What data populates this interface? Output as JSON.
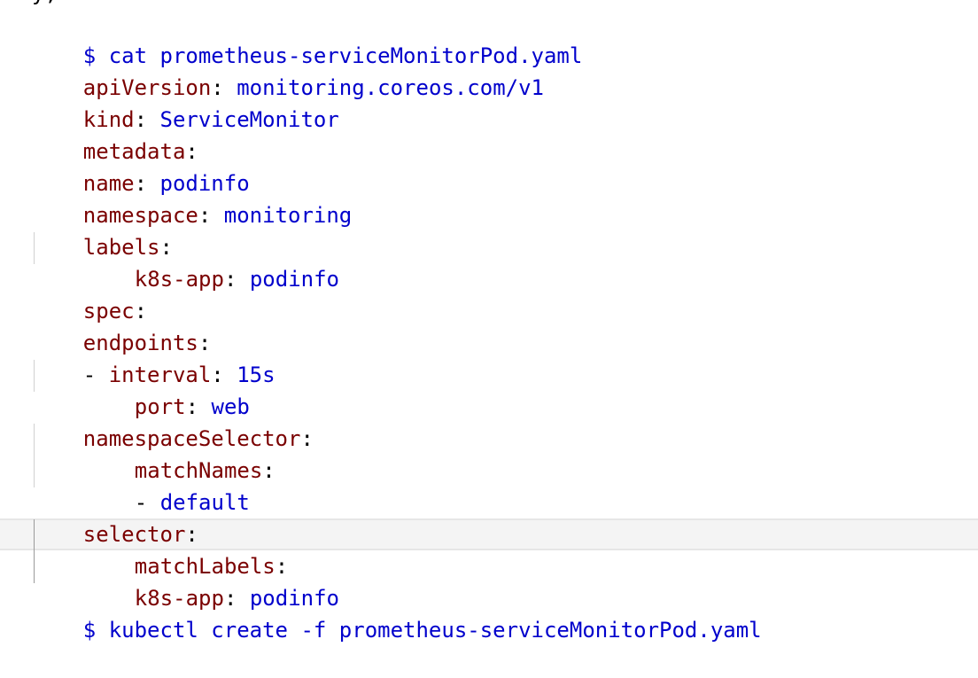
{
  "partial_top_text": "y;",
  "terminal": {
    "prompt": "$",
    "command1": "cat prometheus-serviceMonitorPod.yaml",
    "command2": "kubectl create -f prometheus-serviceMonitorPod.yaml"
  },
  "yaml": {
    "apiVersion": {
      "key": "apiVersion",
      "value": "monitoring.coreos.com/v1"
    },
    "kind": {
      "key": "kind",
      "value": "ServiceMonitor"
    },
    "metadata": {
      "key": "metadata"
    },
    "name": {
      "key": "name",
      "value": "podinfo"
    },
    "namespace": {
      "key": "namespace",
      "value": "monitoring"
    },
    "labels": {
      "key": "labels"
    },
    "labels_k8s_app": {
      "key": "k8s-app",
      "value": "podinfo"
    },
    "spec": {
      "key": "spec"
    },
    "endpoints": {
      "key": "endpoints"
    },
    "interval": {
      "dash": "-",
      "key": "interval",
      "value": "15s"
    },
    "port": {
      "key": "port",
      "value": "web"
    },
    "namespaceSelector": {
      "key": "namespaceSelector"
    },
    "matchNames": {
      "key": "matchNames"
    },
    "matchNames_item": {
      "dash": "-",
      "value": "default"
    },
    "selector": {
      "key": "selector"
    },
    "matchLabels": {
      "key": "matchLabels"
    },
    "matchLabels_k8s_app": {
      "key": "k8s-app",
      "value": "podinfo"
    }
  },
  "colors": {
    "key": "#7a0000",
    "value": "#0000cc",
    "plain": "#000000",
    "current_line": "#f4f4f4"
  }
}
